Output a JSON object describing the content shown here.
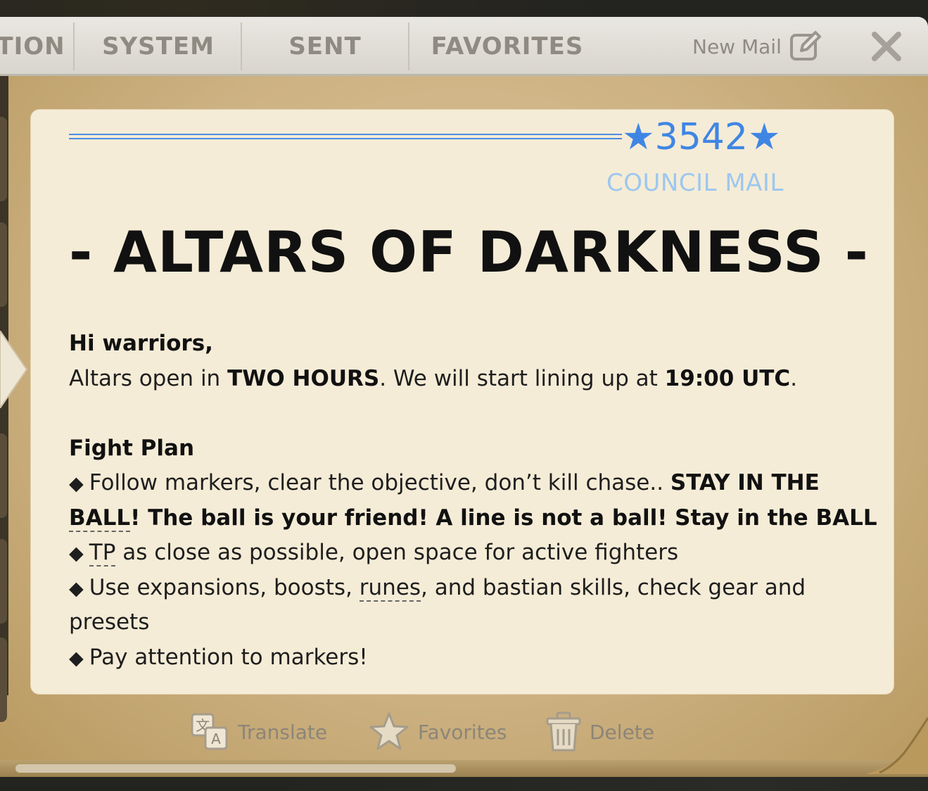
{
  "tabs": [
    {
      "label": "TION"
    },
    {
      "label": "SYSTEM"
    },
    {
      "label": "SENT"
    },
    {
      "label": "FAVORITES"
    }
  ],
  "header": {
    "new_mail_label": "New Mail",
    "new_mail_icon": "edit-icon",
    "close_icon": "close-icon"
  },
  "mail": {
    "sender_badge": "★3542★",
    "sender_type": "COUNCIL MAIL",
    "title": "- ALTARS OF DARKNESS -",
    "greeting": "Hi warriors,",
    "intro_a": "Altars open in ",
    "intro_b": "TWO HOURS",
    "intro_c": ". We will start lining up at ",
    "intro_d": "19:00 UTC",
    "intro_e": ".",
    "plan_heading": "Fight Plan",
    "bullet_symbol": "◆",
    "b1_a": "Follow markers, clear the objective, don’t kill chase..  ",
    "b1_b": "STAY IN THE",
    "b1_c": "BALL",
    "b1_d": "! The ball is your friend! A line is not a ball! Stay in the BALL",
    "b2_a": "TP",
    "b2_b": " as close as possible, open space for active fighters",
    "b3_a": "Use expansions, boosts, ",
    "b3_b": "runes",
    "b3_c": ", and bastian skills, check gear and",
    "b3_d": "presets",
    "b4": "Pay attention to markers!"
  },
  "actions": {
    "translate_label": "Translate",
    "translate_icon": "translate-icon",
    "favorites_label": "Favorites",
    "favorites_icon": "star-icon",
    "delete_label": "Delete",
    "delete_icon": "trash-icon"
  },
  "colors": {
    "accent_blue": "#3f86e4",
    "council_blue": "#9cc7ef",
    "card_bg": "#f5ecd7",
    "tab_text": "#8f8b82"
  }
}
